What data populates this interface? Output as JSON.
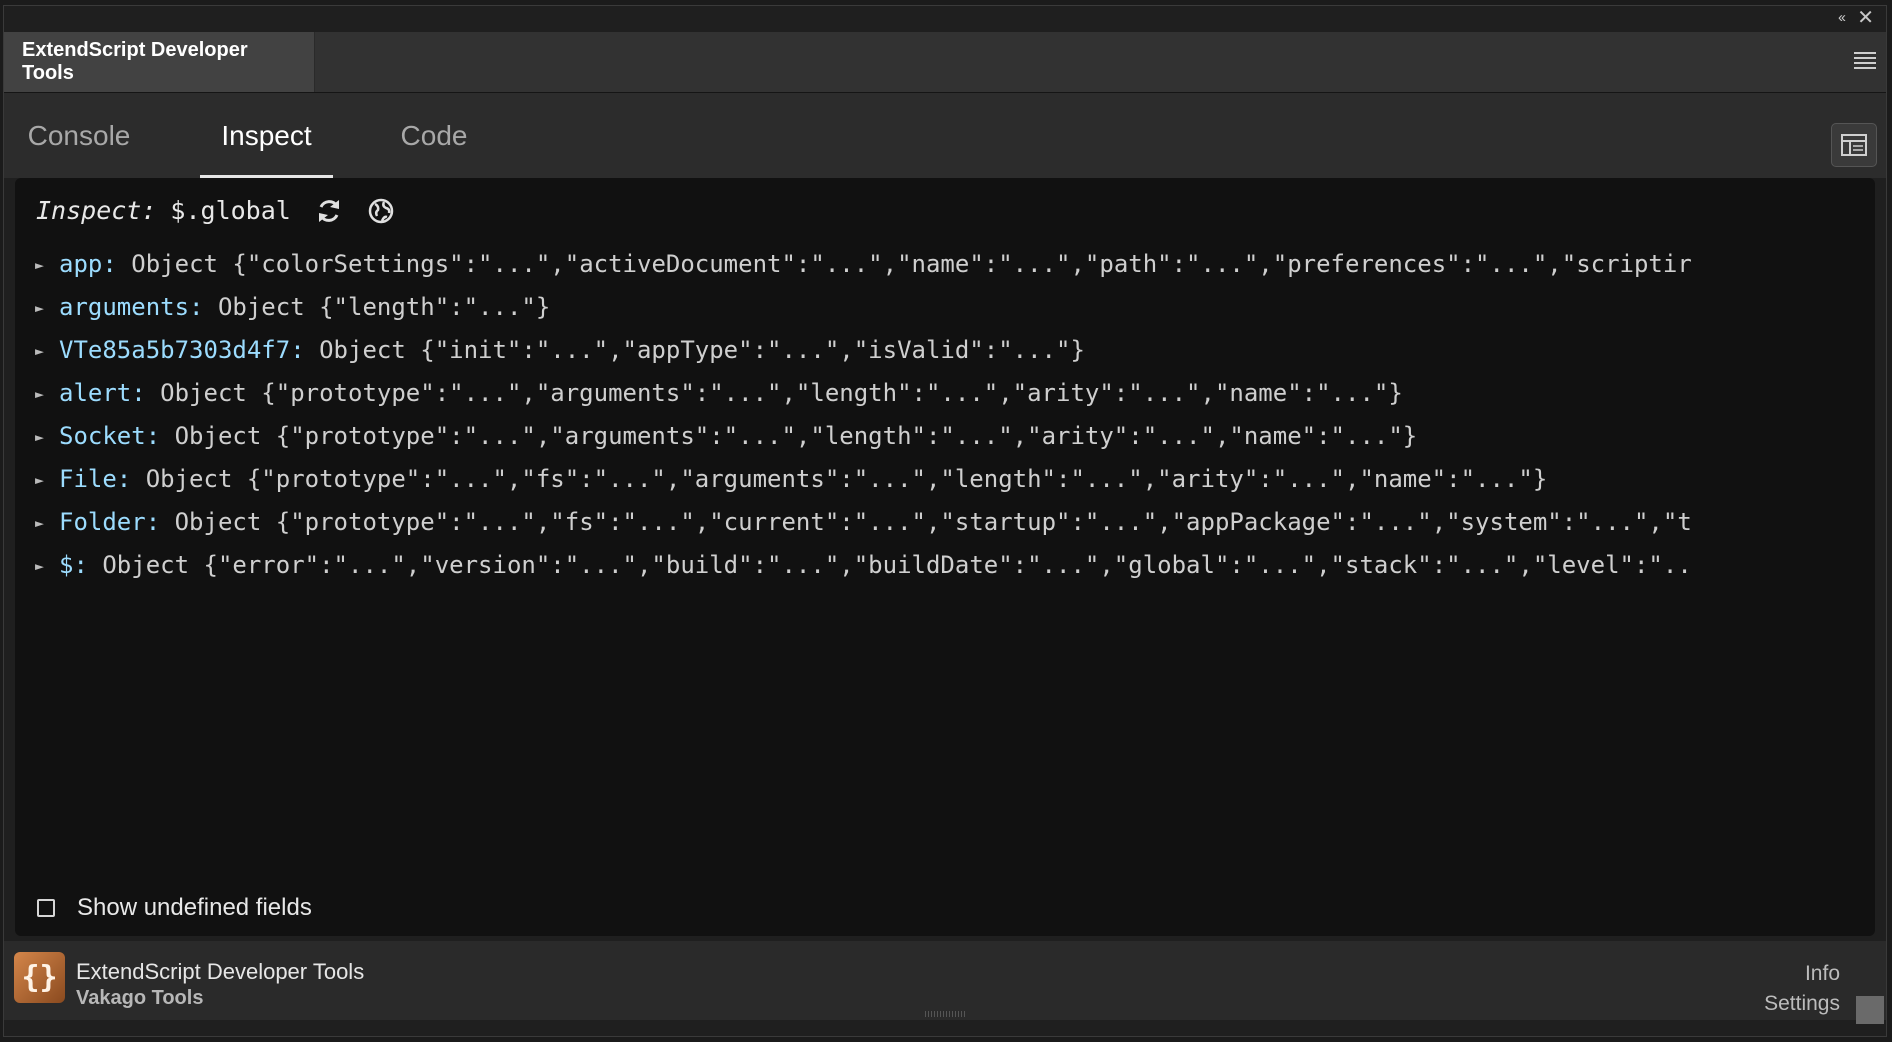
{
  "window": {
    "collapse_glyph": "‹‹",
    "close_glyph": "✕"
  },
  "panel": {
    "title": "ExtendScript Developer Tools"
  },
  "tabs": [
    {
      "label": "Console"
    },
    {
      "label": "Inspect"
    },
    {
      "label": "Code"
    }
  ],
  "inspect": {
    "label": "Inspect:",
    "target": "$.global"
  },
  "tree": [
    {
      "key": "app",
      "value": "Object {\"colorSettings\":\"...\",\"activeDocument\":\"...\",\"name\":\"...\",\"path\":\"...\",\"preferences\":\"...\",\"scriptir"
    },
    {
      "key": "arguments",
      "value": "Object {\"length\":\"...\"}"
    },
    {
      "key": "VTe85a5b7303d4f7",
      "value": "Object {\"init\":\"...\",\"appType\":\"...\",\"isValid\":\"...\"}"
    },
    {
      "key": "alert",
      "value": "Object {\"prototype\":\"...\",\"arguments\":\"...\",\"length\":\"...\",\"arity\":\"...\",\"name\":\"...\"}"
    },
    {
      "key": "Socket",
      "value": "Object {\"prototype\":\"...\",\"arguments\":\"...\",\"length\":\"...\",\"arity\":\"...\",\"name\":\"...\"}"
    },
    {
      "key": "File",
      "value": "Object {\"prototype\":\"...\",\"fs\":\"...\",\"arguments\":\"...\",\"length\":\"...\",\"arity\":\"...\",\"name\":\"...\"}"
    },
    {
      "key": "Folder",
      "value": "Object {\"prototype\":\"...\",\"fs\":\"...\",\"current\":\"...\",\"startup\":\"...\",\"appPackage\":\"...\",\"system\":\"...\",\"t"
    },
    {
      "key": "$",
      "value": "Object {\"error\":\"...\",\"version\":\"...\",\"build\":\"...\",\"buildDate\":\"...\",\"global\":\"...\",\"stack\":\"...\",\"level\":\".."
    }
  ],
  "options": {
    "show_undefined_label": "Show undefined fields",
    "show_undefined_checked": false
  },
  "footer": {
    "logo_text": "{}",
    "product_name": "ExtendScript Developer Tools",
    "vendor": "Vakago Tools",
    "info_link": "Info",
    "settings_link": "Settings"
  },
  "colors": {
    "key": "#9cdcfe",
    "value": "#cfcfcf",
    "background": "#111111",
    "accent_logo": "#d4864a"
  }
}
